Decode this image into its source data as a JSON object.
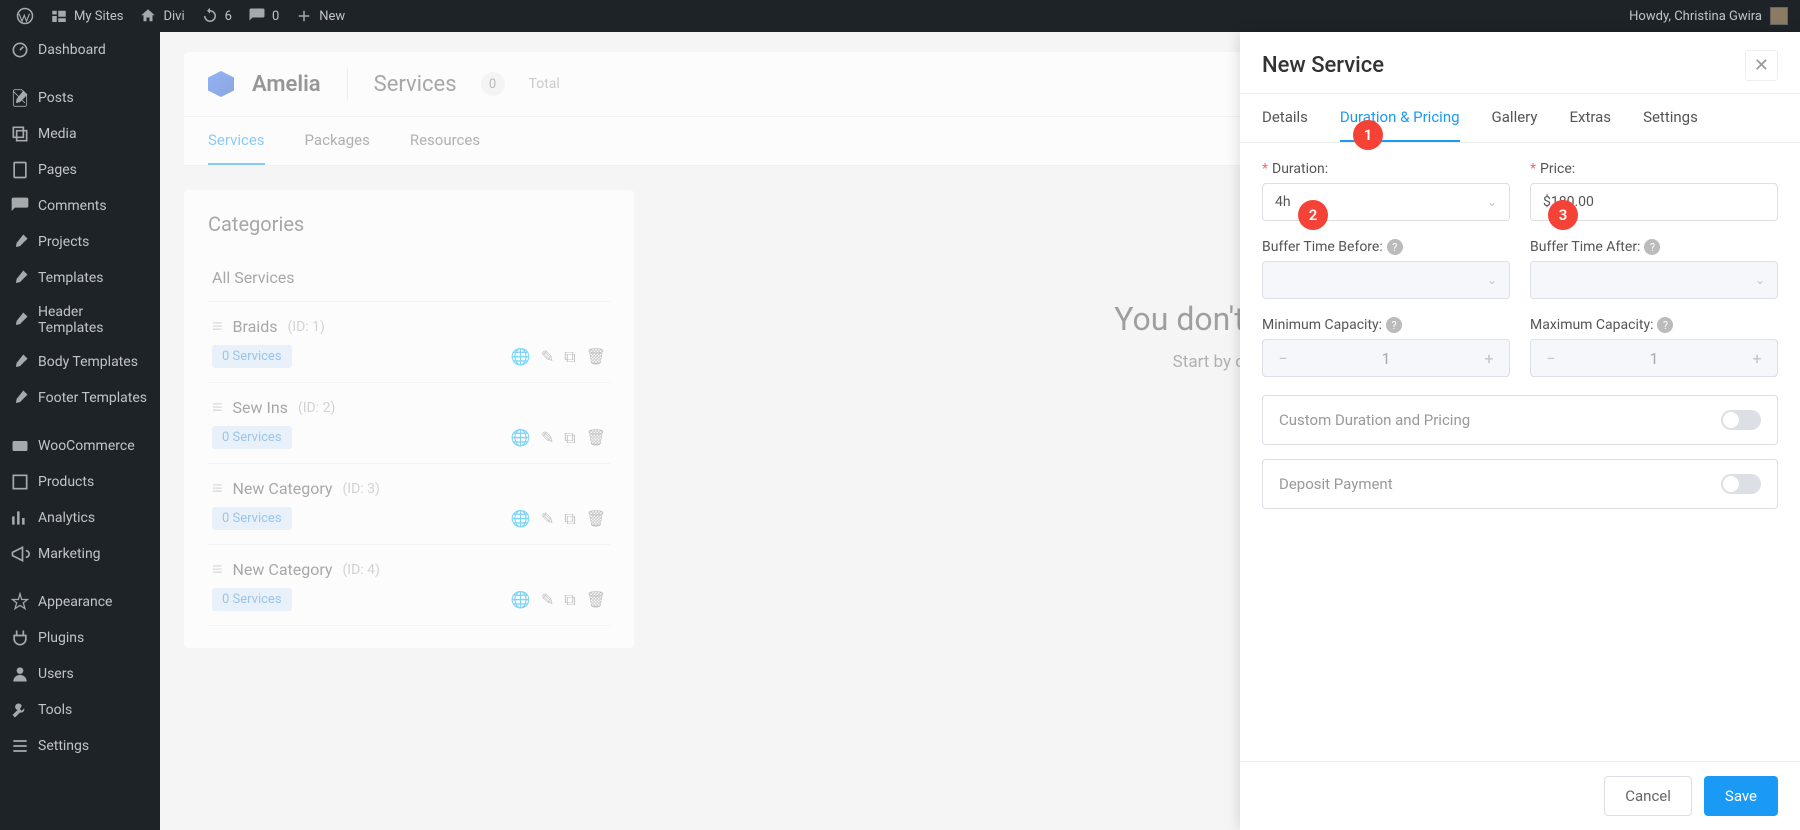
{
  "wpbar": {
    "mysites": "My Sites",
    "site": "Divi",
    "updates": "6",
    "comments": "0",
    "new": "New",
    "howdy": "Howdy, Christina Gwira"
  },
  "wpside": {
    "dashboard": "Dashboard",
    "posts": "Posts",
    "media": "Media",
    "pages": "Pages",
    "comments": "Comments",
    "projects": "Projects",
    "templates": "Templates",
    "header_templates": "Header Templates",
    "body_templates": "Body Templates",
    "footer_templates": "Footer Templates",
    "woo": "WooCommerce",
    "products": "Products",
    "analytics": "Analytics",
    "marketing": "Marketing",
    "appearance": "Appearance",
    "plugins": "Plugins",
    "users": "Users",
    "tools": "Tools",
    "settings": "Settings"
  },
  "page": {
    "brand": "Amelia",
    "title": "Services",
    "count": "0",
    "total": "Total",
    "tabs": {
      "services": "Services",
      "packages": "Packages",
      "resources": "Resources"
    }
  },
  "categories": {
    "heading": "Categories",
    "all": "All Services",
    "items": [
      {
        "name": "Braids",
        "id": "(ID: 1)",
        "badge": "0 Services"
      },
      {
        "name": "Sew Ins",
        "id": "(ID: 2)",
        "badge": "0 Services"
      },
      {
        "name": "New Category",
        "id": "(ID: 3)",
        "badge": "0 Services"
      },
      {
        "name": "New Category",
        "id": "(ID: 4)",
        "badge": "0 Services"
      }
    ]
  },
  "empty": {
    "title": "You don't have",
    "sub": "Start by clic"
  },
  "drawer": {
    "title": "New Service",
    "tabs": {
      "details": "Details",
      "duration": "Duration & Pricing",
      "gallery": "Gallery",
      "extras": "Extras",
      "settings": "Settings"
    },
    "labels": {
      "duration": "Duration:",
      "price": "Price:",
      "bbefore": "Buffer Time Before:",
      "bafter": "Buffer Time After:",
      "mincap": "Minimum Capacity:",
      "maxcap": "Maximum Capacity:",
      "custom": "Custom Duration and Pricing",
      "deposit": "Deposit Payment"
    },
    "values": {
      "duration": "4h",
      "price": "$180.00",
      "mincap": "1",
      "maxcap": "1"
    },
    "buttons": {
      "cancel": "Cancel",
      "save": "Save"
    }
  },
  "annotations": {
    "a1": "1",
    "a2": "2",
    "a3": "3"
  }
}
